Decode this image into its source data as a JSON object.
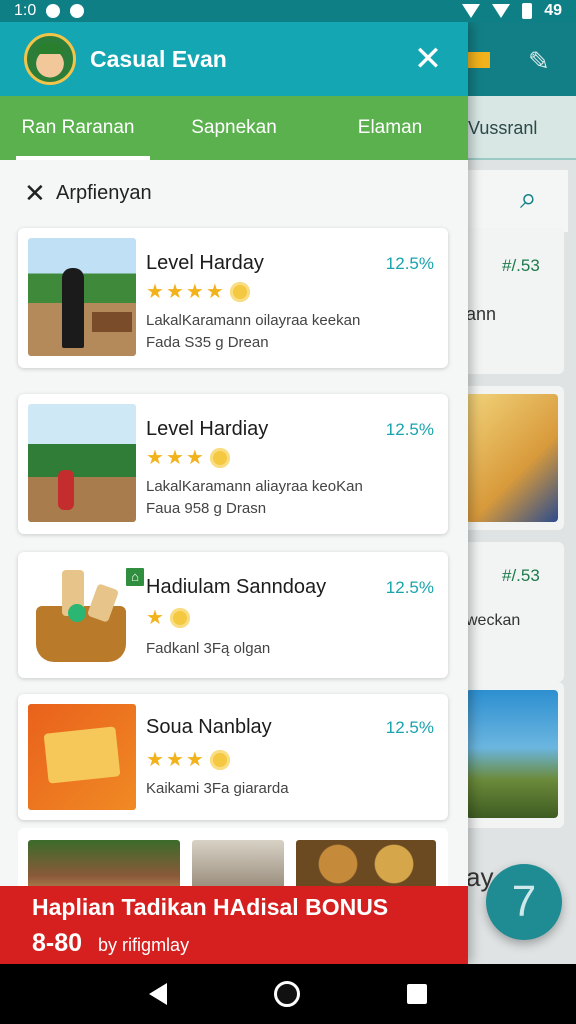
{
  "status_bar": {
    "time": "1:0",
    "signal_text": "49"
  },
  "drawer": {
    "header": {
      "title": "Casual Evan"
    },
    "tabs": [
      {
        "label": "Ran Raranan",
        "active": true
      },
      {
        "label": "Sapnekan",
        "active": false
      },
      {
        "label": "Elaman",
        "active": false
      }
    ],
    "filter": {
      "label": "Arpfienyan"
    },
    "items": [
      {
        "title": "Level Harday",
        "percent": "12.5%",
        "stars": 4,
        "line1": "LakalKaramann oilayraa keekan",
        "line2": "Fada S35 g Drean"
      },
      {
        "title": "Level Hardiay",
        "percent": "12.5%",
        "stars": 3,
        "line1": "LakalKaramann aliayraa keoKan",
        "line2": "Faua 958 g Drasn"
      },
      {
        "title": "Hadiulam Sanndoay",
        "percent": "12.5%",
        "stars": 1,
        "line1": "Fadkanl 3Fą olgan",
        "line2": ""
      },
      {
        "title": "Soua Nanblay",
        "percent": "12.5%",
        "stars": 3,
        "line1": "Kaikami 3Fa giararda",
        "line2": ""
      }
    ]
  },
  "background_app": {
    "tab_label": "Vussranl",
    "prices": [
      "#/.53",
      "#/.53"
    ],
    "texts": [
      "ann",
      "weckan",
      "ay"
    ],
    "fab_label": "7"
  },
  "banner": {
    "title": "Haplian Tadikan HAdisal BONUS",
    "number": "8-80",
    "by": "by rifigmlay"
  },
  "colors": {
    "header": "#15a6b4",
    "tabs": "#5cb14f",
    "banner": "#d5201f",
    "accent": "#19a4ad"
  }
}
